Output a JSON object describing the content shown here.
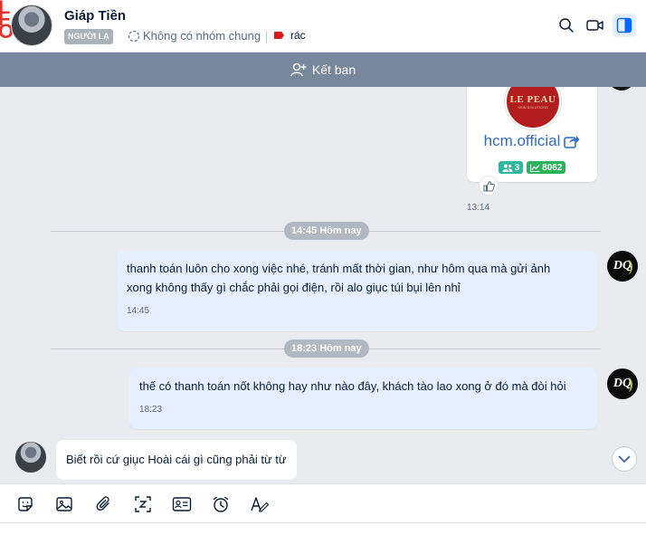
{
  "header": {
    "contact_name": "Giáp Tiền",
    "stranger_tag": "NGƯỜI LẠ",
    "group_info": "Không có nhóm chung",
    "label": "rác",
    "label_color": "#d91b1b",
    "icons": [
      "search-icon",
      "video-call-icon",
      "sidebar-toggle-icon"
    ]
  },
  "add_friend": {
    "label": "Kết bạn"
  },
  "messages": {
    "card": {
      "name": "hcm.official",
      "logo_text": "LE PEAU",
      "logo_subtext": "SKIN SOLUTIONS",
      "members": "3",
      "followers": "8062",
      "time": "13:14"
    },
    "sep1": "14:45 Hôm nay",
    "msg1": {
      "line1": "thanh toán luôn cho xong việc nhé, tránh mất thời gian, như hôm qua mà gửi ảnh",
      "line2": "xong không thấy gì chắc phải gọi điện, rồi alo giục túi bụi lên nhỉ",
      "time": "14:45"
    },
    "sep2": "18:23 Hôm nay",
    "msg2": {
      "text": "thế có thanh toán nốt không hay như nào đây, khách tào lao xong ở đó mà đòi hỏi",
      "time": "18:23"
    },
    "incoming": {
      "text": "Biết rồi cứ giục Hoài cái gì cũng phải từ từ"
    },
    "avatar_initials": "DQ"
  },
  "colors": {
    "outgoing_bubble": "#e5efff",
    "add_friend_bar": "#78879b",
    "accent": "#0068ff"
  },
  "toolbar": {
    "tools": [
      "sticker-icon",
      "image-icon",
      "attachment-icon",
      "screenshot-icon",
      "contact-card-icon",
      "reminder-icon",
      "text-format-icon"
    ]
  }
}
